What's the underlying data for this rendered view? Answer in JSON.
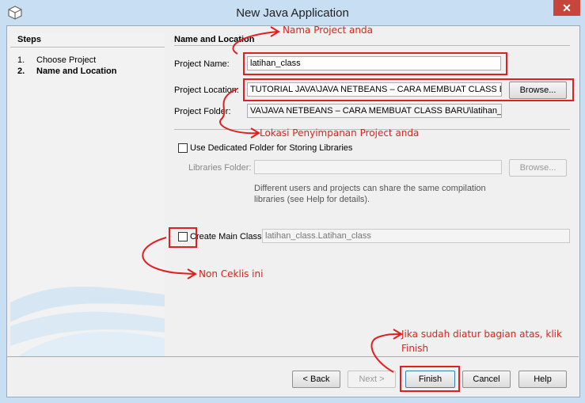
{
  "window": {
    "title": "New Java Application",
    "close_glyph": "✕"
  },
  "steps": {
    "title": "Steps",
    "items": [
      {
        "num": "1.",
        "label": "Choose Project"
      },
      {
        "num": "2.",
        "label": "Name and Location"
      }
    ]
  },
  "form": {
    "section_title": "Name and Location",
    "project_name_label": "Project Name:",
    "project_name_value": "latihan_class",
    "project_location_label": "Project Location:",
    "project_location_value": "TUTORIAL JAVA\\JAVA NETBEANS – CARA MEMBUAT CLASS BARU",
    "project_folder_label": "Project Folder:",
    "project_folder_value": "VA\\JAVA NETBEANS – CARA MEMBUAT CLASS BARU\\latihan_class",
    "browse_label": "Browse...",
    "dedicated_folder_label": "Use Dedicated Folder for Storing Libraries",
    "libraries_folder_label": "Libraries Folder:",
    "libraries_folder_value": "",
    "libraries_browse_label": "Browse...",
    "help_text": "Different users and projects can share the same compilation libraries (see Help for details).",
    "create_main_label": "Create Main Class",
    "create_main_value": "latihan_class.Latihan_class"
  },
  "buttons": {
    "back": "< Back",
    "next": "Next >",
    "finish": "Finish",
    "cancel": "Cancel",
    "help": "Help"
  },
  "annotations": {
    "project_name": "Nama Project anda",
    "location": "Lokasi Penyimpanan Project anda",
    "uncheck": "Non Ceklis ini",
    "finish_line1": "Jika sudah diatur bagian atas, klik",
    "finish_line2": "Finish"
  },
  "colors": {
    "annotation": "#e02020",
    "title_bar": "#c8def2"
  }
}
